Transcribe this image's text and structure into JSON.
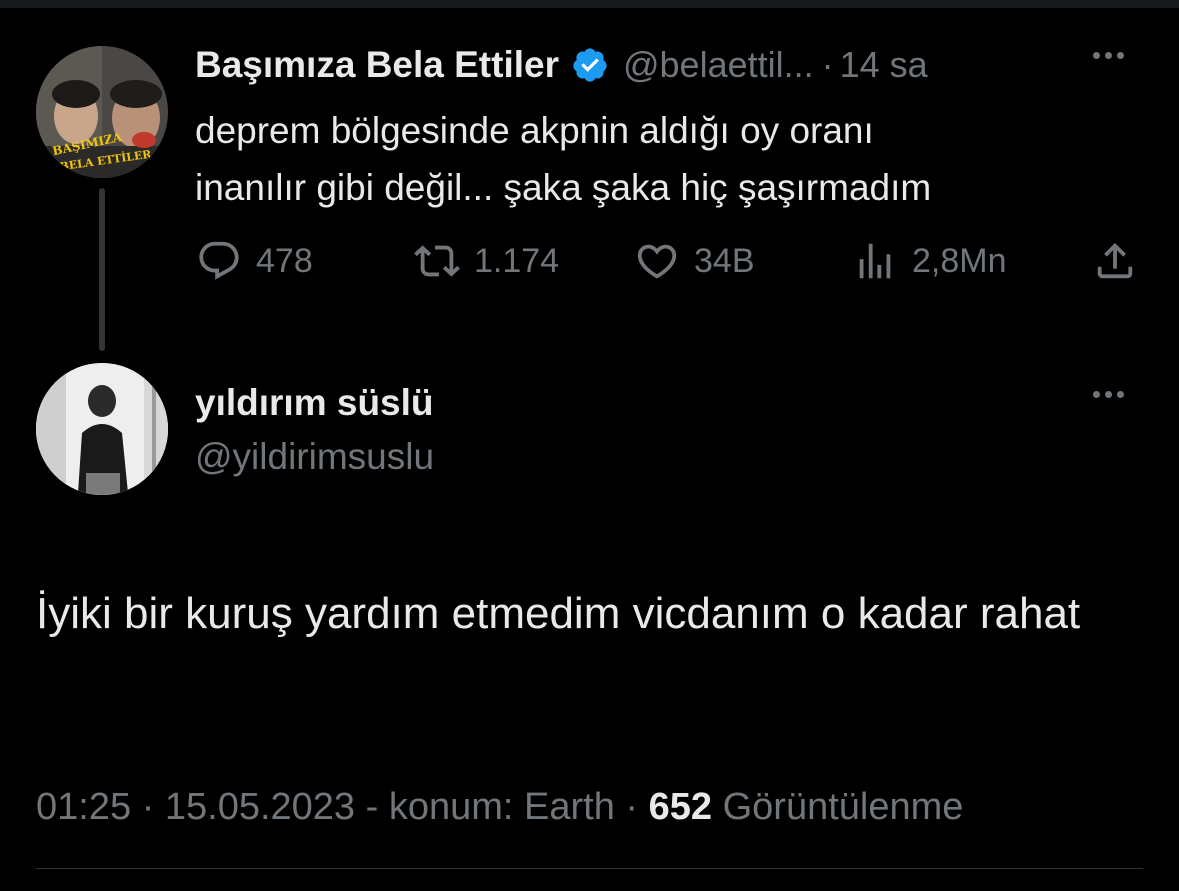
{
  "quoted_tweet": {
    "display_name": "Başımıza Bela Ettiler",
    "handle": "@belaettil...",
    "separator": "·",
    "time": "14 sa",
    "avatar_text_line1": "BAŞIMIZA",
    "avatar_text_line2": "BELA ETTİLER",
    "text_line1": "deprem bölgesinde akpnin aldığı oy oranı",
    "text_line2": "inanılır gibi değil... şaka şaka hiç şaşırmadım",
    "replies": "478",
    "retweets": "1.174",
    "likes": "34B",
    "views": "2,8Mn"
  },
  "main_tweet": {
    "display_name": "yıldırım süslü",
    "handle": "@yildirimsuslu",
    "text": "İyiki bir kuruş yardım etmedim vicdanım o kadar rahat",
    "time": "01:25",
    "dot1": "·",
    "date": "15.05.2023",
    "location": "- konum: Earth",
    "dot2": "·",
    "view_count": "652",
    "view_label": "Görüntülenme"
  },
  "colors": {
    "background": "#000000",
    "text": "#e7e9ea",
    "muted": "#71767b",
    "verified": "#1d9bf0"
  }
}
